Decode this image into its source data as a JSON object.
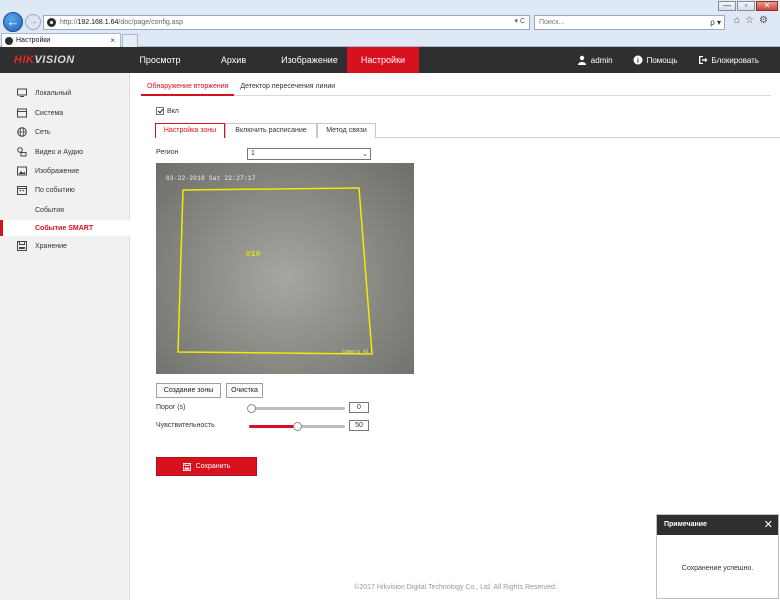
{
  "browser": {
    "address_prefix": "http://",
    "address_host": "192.168.1.64",
    "address_path": "/doc/page/config.asp",
    "address_tools": "▾ C",
    "search_placeholder": "Поиск...",
    "search_tools": "ρ ▾",
    "tab_title": "Настройки",
    "tab_close": "×",
    "win_min": "—",
    "win_max": "▫",
    "win_close": "✕"
  },
  "header": {
    "logo_red": "HIK",
    "logo_grey": "VISION",
    "nav": [
      {
        "label": "Просмотр"
      },
      {
        "label": "Архив"
      },
      {
        "label": "Изображение"
      },
      {
        "label": "Настройки"
      }
    ],
    "user": "admin",
    "help": "Помощь",
    "lock": "Блокировать"
  },
  "sidebar": {
    "items": [
      {
        "label": "Локальный",
        "icon": "monitor-icon"
      },
      {
        "label": "Система",
        "icon": "system-icon"
      },
      {
        "label": "Сеть",
        "icon": "globe-icon"
      },
      {
        "label": "Видео и Аудио",
        "icon": "video-audio-icon"
      },
      {
        "label": "Изображение",
        "icon": "image-icon"
      },
      {
        "label": "По событию",
        "icon": "calendar-icon"
      }
    ],
    "sub_items": [
      {
        "label": "События"
      },
      {
        "label": "Событие SMART"
      }
    ],
    "storage": {
      "label": "Хранение",
      "icon": "disk-icon"
    }
  },
  "content": {
    "tabs": [
      {
        "label": "Обнаружение вторжения"
      },
      {
        "label": "Детектор пересечения линии"
      }
    ],
    "enable_label": "Вкл",
    "steps": [
      {
        "label": "Настройка зоны"
      },
      {
        "label": "Включить расписание"
      },
      {
        "label": "Метод связи"
      }
    ],
    "region_label": "Регион",
    "region_value": "1",
    "video": {
      "timestamp": "03-22-2018 Sat 22:27:17",
      "camera_name": "Camera 01",
      "zone_label": "#1#"
    },
    "create_zone_label": "Создание зоны",
    "clear_label": "Очистка",
    "threshold_label": "Порог (s)",
    "threshold_value": "0",
    "threshold_fraction": 0,
    "sensitivity_label": "Чувствительность",
    "sensitivity_value": "50",
    "sensitivity_fraction": 0.5,
    "save_label": "Сохранить",
    "footer": "©2017 Hikvision Digital Technology Co., Ltd. All Rights Reserved."
  },
  "notice": {
    "title": "Примечание",
    "message": "Сохранение успешно.",
    "close": "✕"
  },
  "colors": {
    "accent": "#d7111d",
    "header_bg": "#2f2f2f",
    "zone_line": "#f2ea00"
  }
}
